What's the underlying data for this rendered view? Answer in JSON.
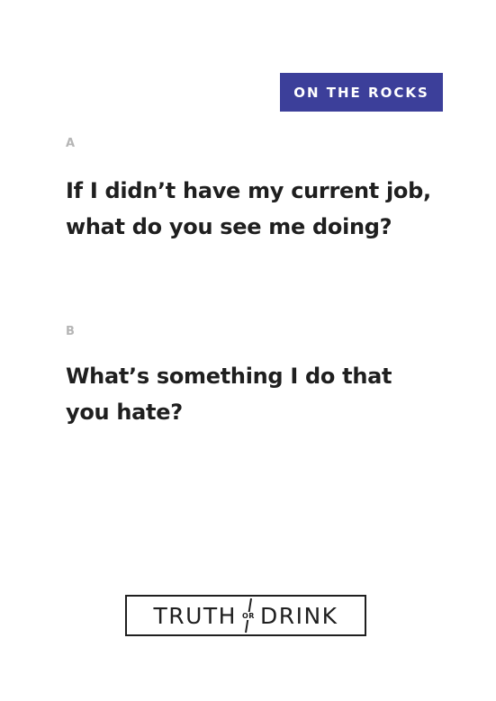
{
  "card": {
    "category": "ON THE ROCKS",
    "category_color": "#3c3f9a",
    "option_a": {
      "letter": "A",
      "question": "If I didn’t have my current job, what do you see me doing?"
    },
    "option_b": {
      "letter": "B",
      "question": "What’s something I do that you hate?"
    }
  },
  "logo": {
    "word_left": "TRUTH",
    "word_middle": "OR",
    "word_right": "DRINK"
  }
}
